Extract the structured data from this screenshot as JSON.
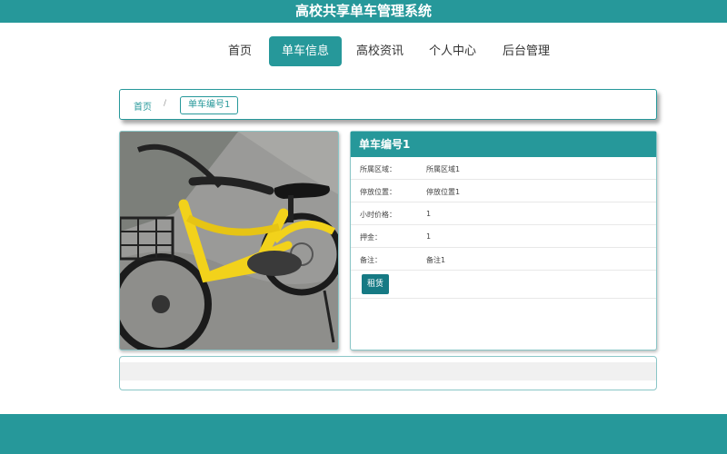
{
  "header": {
    "title": "高校共享单车管理系统"
  },
  "nav": {
    "items": [
      "首页",
      "单车信息",
      "高校资讯",
      "个人中心",
      "后台管理"
    ],
    "active": "单车信息"
  },
  "breadcrumb": {
    "home": "首页",
    "separator": "/",
    "current": "单车编号1"
  },
  "detail": {
    "title": "单车编号1",
    "rows": [
      {
        "label": "所属区域：",
        "value": "所属区域1"
      },
      {
        "label": "停放位置：",
        "value": "停放位置1"
      },
      {
        "label": "小时价格：",
        "value": "1"
      },
      {
        "label": "押金：",
        "value": "1"
      },
      {
        "label": "备注：",
        "value": "备注1"
      }
    ],
    "rent_button": "租赁"
  },
  "colors": {
    "primary": "#26989a",
    "button": "#167a84",
    "border": "#8ac6c7"
  },
  "images": {
    "bike_photo": "yellow-shared-bicycle-photo"
  }
}
